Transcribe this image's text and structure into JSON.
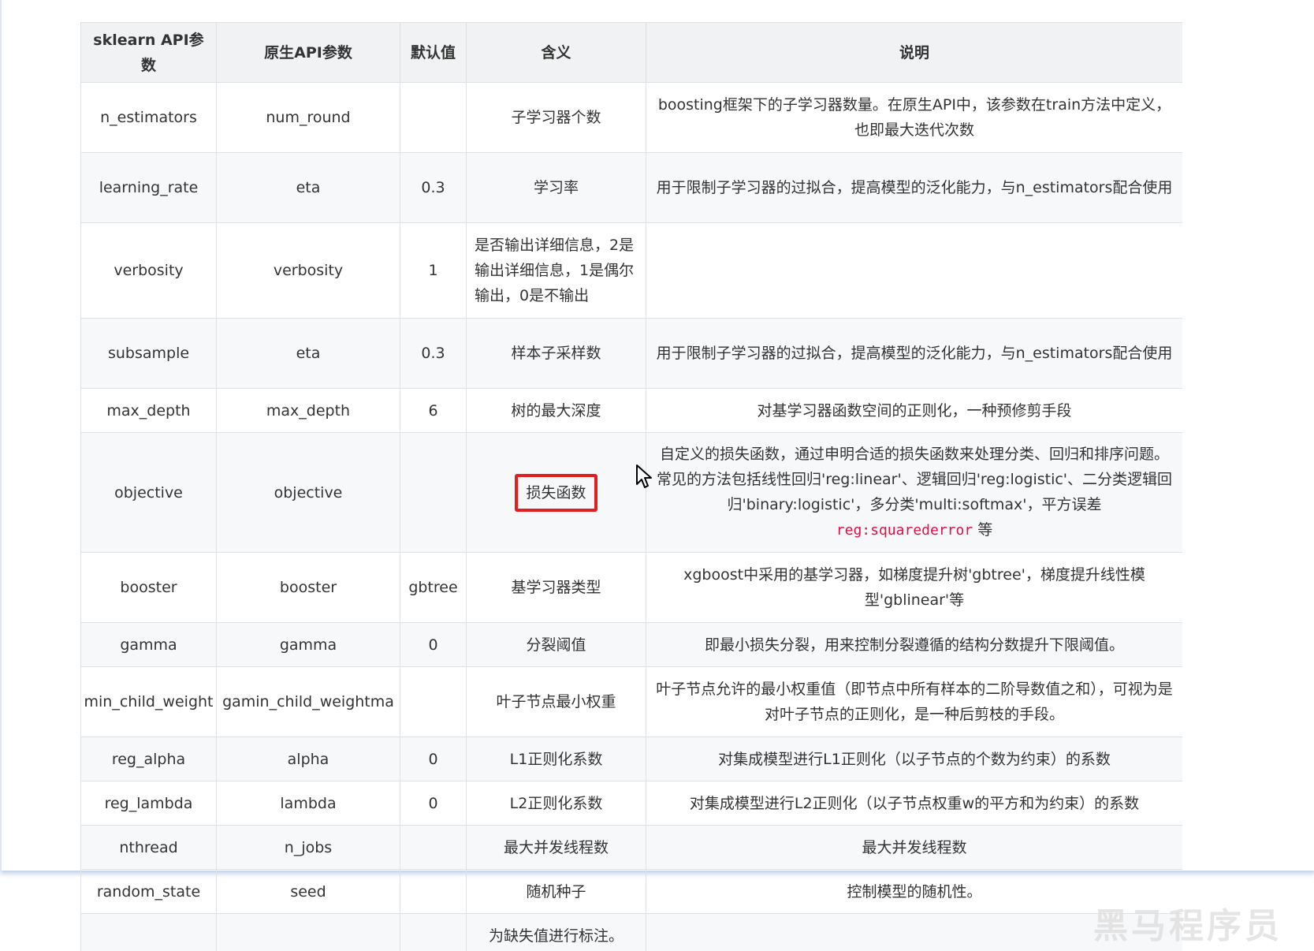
{
  "table": {
    "headers": [
      "sklearn API参数",
      "原生API参数",
      "默认值",
      "含义",
      "说明"
    ],
    "rows": [
      [
        "n_estimators",
        "num_round",
        "",
        "子学习器个数",
        "boosting框架下的子学习器数量。在原生API中，该参数在train方法中定义，也即最大迭代次数"
      ],
      [
        "learning_rate",
        "eta",
        "0.3",
        "学习率",
        "用于限制子学习器的过拟合，提高模型的泛化能力，与n_estimators配合使用"
      ],
      [
        "verbosity",
        "verbosity",
        "1",
        "是否输出详细信息，2是输出详细信息，1是偶尔输出，0是不输出",
        ""
      ],
      [
        "subsample",
        "eta",
        "0.3",
        "样本子采样数",
        "用于限制子学习器的过拟合，提高模型的泛化能力，与n_estimators配合使用"
      ],
      [
        "max_depth",
        "max_depth",
        "6",
        "树的最大深度",
        "对基学习器函数空间的正则化，一种预修剪手段"
      ],
      [
        "objective",
        "objective",
        "",
        "损失函数",
        "自定义的损失函数，通过申明合适的损失函数来处理分类、回归和排序问题。常见的方法包括线性回归'reg:linear'、逻辑回归'reg:logistic'、二分类逻辑回归'binary:logistic'，多分类'multi:softmax'，平方误差"
      ],
      [
        "booster",
        "booster",
        "gbtree",
        "基学习器类型",
        "xgboost中采用的基学习器，如梯度提升树'gbtree'，梯度提升线性模型'gblinear'等"
      ],
      [
        "gamma",
        "gamma",
        "0",
        "分裂阈值",
        "即最小损失分裂，用来控制分裂遵循的结构分数提升下限阈值。"
      ],
      [
        "min_child_weight",
        "gamin_child_weightma",
        "",
        "叶子节点最小权重",
        "叶子节点允许的最小权重值（即节点中所有样本的二阶导数值之和），可视为是对叶子节点的正则化，是一种后剪枝的手段。"
      ],
      [
        "reg_alpha",
        "alpha",
        "0",
        "L1正则化系数",
        "对集成模型进行L1正则化（以子节点的个数为约束）的系数"
      ],
      [
        "reg_lambda",
        "lambda",
        "0",
        "L2正则化系数",
        "对集成模型进行L2正则化（以子节点权重w的平方和为约束）的系数"
      ],
      [
        "nthread",
        "n_jobs",
        "",
        "最大并发线程数",
        "最大并发线程数"
      ],
      [
        "random_state",
        "seed",
        "",
        "随机种子",
        "控制模型的随机性。"
      ],
      [
        "",
        "",
        "",
        "为缺失值进行标注。",
        ""
      ]
    ],
    "objective_code": "reg:squarederror",
    "objective_suffix": " 等"
  },
  "watermark": "黑马程序员",
  "colors": {
    "highlight_border": "#e02020",
    "header_bg": "#f0f2f3",
    "code_color": "#dd1144"
  }
}
